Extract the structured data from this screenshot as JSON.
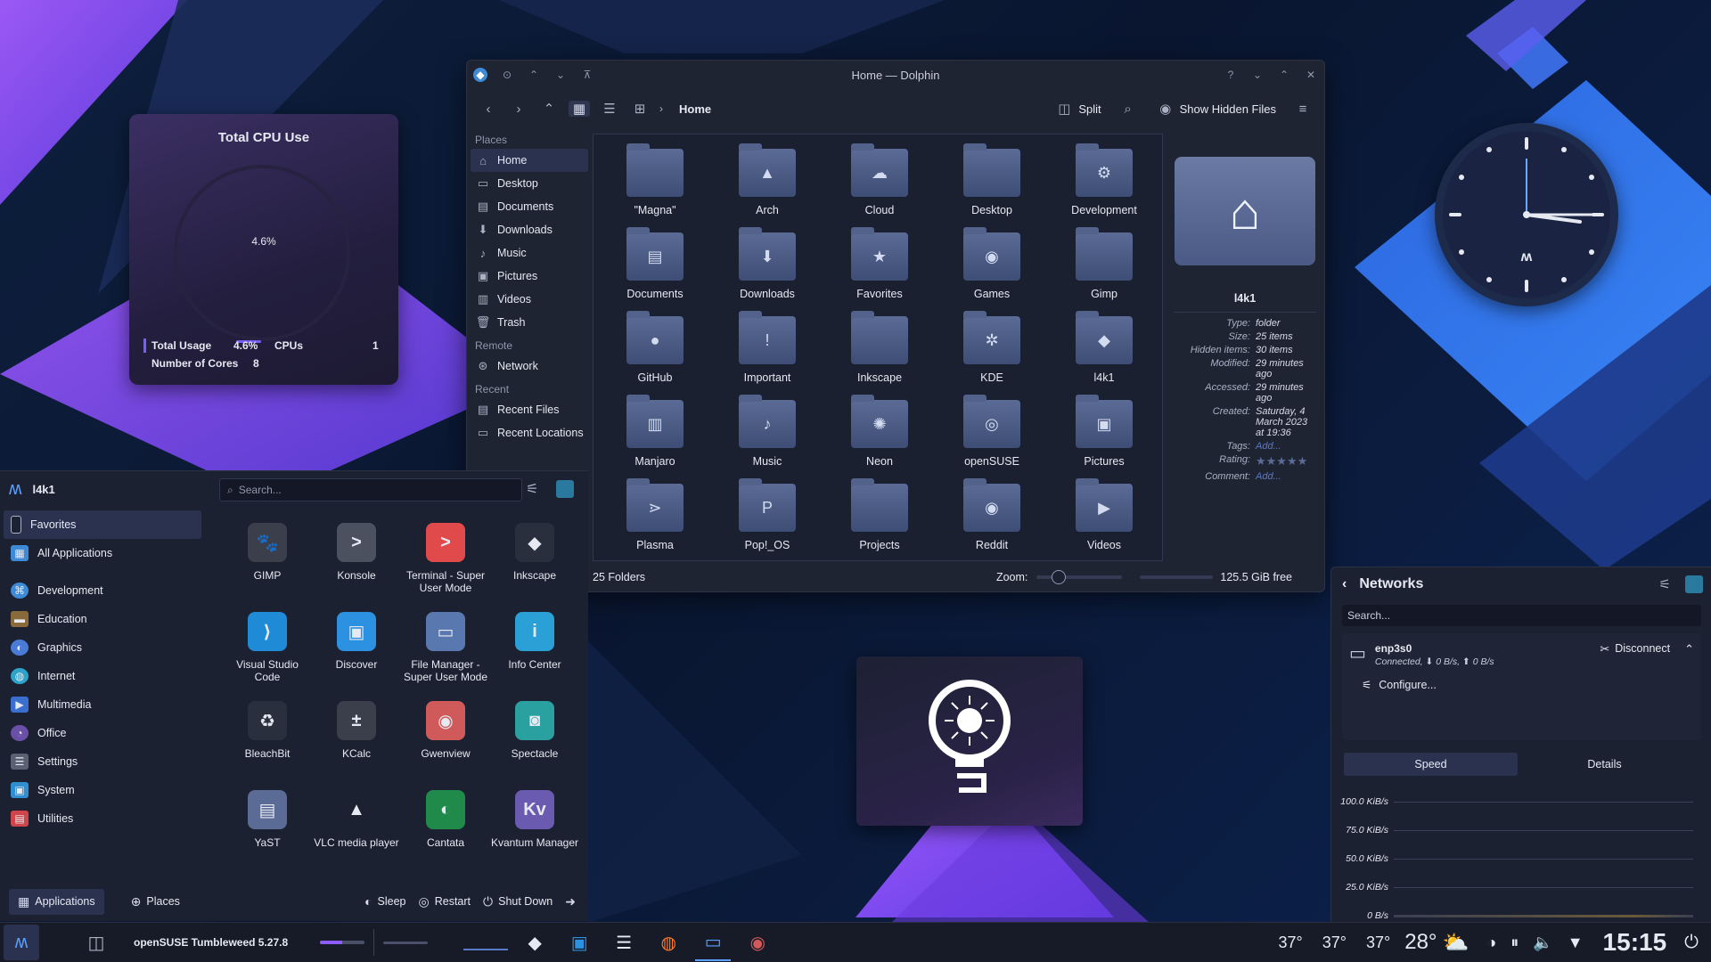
{
  "cpu_widget": {
    "title": "Total CPU Use",
    "percent": "4.6%",
    "total_usage_label": "Total Usage",
    "total_usage_value": "4.6%",
    "cpus_label": "CPUs",
    "cpus_value": "1",
    "cores_label": "Number of Cores",
    "cores_value": "8"
  },
  "dolphin": {
    "title": "Home — Dolphin",
    "breadcrumb": "Home",
    "split_label": "Split",
    "hidden_label": "Show Hidden Files",
    "places_header": "Places",
    "remote_header": "Remote",
    "recent_header": "Recent",
    "places": [
      {
        "label": "Home"
      },
      {
        "label": "Desktop"
      },
      {
        "label": "Documents"
      },
      {
        "label": "Downloads"
      },
      {
        "label": "Music"
      },
      {
        "label": "Pictures"
      },
      {
        "label": "Videos"
      },
      {
        "label": "Trash"
      }
    ],
    "remote": [
      {
        "label": "Network"
      }
    ],
    "recent": [
      {
        "label": "Recent Files"
      },
      {
        "label": "Recent Locations"
      }
    ],
    "folders": [
      {
        "name": "\"Magna\"",
        "glyph": ""
      },
      {
        "name": "Arch",
        "glyph": "▲"
      },
      {
        "name": "Cloud",
        "glyph": "☁"
      },
      {
        "name": "Desktop",
        "glyph": ""
      },
      {
        "name": "Development",
        "glyph": "⚙"
      },
      {
        "name": "Documents",
        "glyph": "▤"
      },
      {
        "name": "Downloads",
        "glyph": "⬇"
      },
      {
        "name": "Favorites",
        "glyph": "★"
      },
      {
        "name": "Games",
        "glyph": "◉"
      },
      {
        "name": "Gimp",
        "glyph": ""
      },
      {
        "name": "GitHub",
        "glyph": "●"
      },
      {
        "name": "Important",
        "glyph": "!"
      },
      {
        "name": "Inkscape",
        "glyph": ""
      },
      {
        "name": "KDE",
        "glyph": "✲"
      },
      {
        "name": "l4k1",
        "glyph": "◆"
      },
      {
        "name": "Manjaro",
        "glyph": "▥"
      },
      {
        "name": "Music",
        "glyph": "♪"
      },
      {
        "name": "Neon",
        "glyph": "✺"
      },
      {
        "name": "openSUSE",
        "glyph": "◎"
      },
      {
        "name": "Pictures",
        "glyph": "▣"
      },
      {
        "name": "Plasma",
        "glyph": "⋗"
      },
      {
        "name": "Pop!_OS",
        "glyph": "P"
      },
      {
        "name": "Projects",
        "glyph": ""
      },
      {
        "name": "Reddit",
        "glyph": "◉"
      },
      {
        "name": "Videos",
        "glyph": "▶"
      }
    ],
    "info": {
      "name": "l4k1",
      "type_label": "Type:",
      "type": "folder",
      "size_label": "Size:",
      "size": "25 items",
      "hidden_label": "Hidden items:",
      "hidden": "30 items",
      "modified_label": "Modified:",
      "modified": "29 minutes ago",
      "accessed_label": "Accessed:",
      "accessed": "29 minutes ago",
      "created_label": "Created:",
      "created": "Saturday, 4 March 2023 at 19:36",
      "tags_label": "Tags:",
      "tags": "Add...",
      "rating_label": "Rating:",
      "rating": "★★★★★",
      "comment_label": "Comment:",
      "comment": "Add..."
    },
    "status_folders": "25 Folders",
    "zoom_label": "Zoom:",
    "free_space": "125.5 GiB free",
    "zoom_level": 0.2
  },
  "launcher": {
    "user": "l4k1",
    "search_placeholder": "Search...",
    "categories": [
      {
        "label": "Favorites",
        "color": "#1b2233"
      },
      {
        "label": "All Applications",
        "color": "#3d8bd6"
      },
      {
        "label": "Development",
        "color": "#3d8bd6"
      },
      {
        "label": "Education",
        "color": "#8a6a3a"
      },
      {
        "label": "Graphics",
        "color": "#4a7bd6"
      },
      {
        "label": "Internet",
        "color": "#2ea3c9"
      },
      {
        "label": "Multimedia",
        "color": "#3a6fd0"
      },
      {
        "label": "Office",
        "color": "#6a4fa8"
      },
      {
        "label": "Settings",
        "color": "#5a6172"
      },
      {
        "label": "System",
        "color": "#2f8fd0"
      },
      {
        "label": "Utilities",
        "color": "#d0454a"
      }
    ],
    "apps": [
      {
        "label": "GIMP",
        "bg": "#3b3f4c",
        "glyph": "🐾"
      },
      {
        "label": "Konsole",
        "bg": "#4c5160",
        "glyph": ">"
      },
      {
        "label": "Terminal - Super User Mode",
        "bg": "#e04a4a",
        "glyph": ">"
      },
      {
        "label": "Inkscape",
        "bg": "#2a2f3d",
        "glyph": "◆"
      },
      {
        "label": "Visual Studio Code",
        "bg": "#1f8ad6",
        "glyph": "⟩"
      },
      {
        "label": "Discover",
        "bg": "#2b91e0",
        "glyph": "▣"
      },
      {
        "label": "File Manager - Super User Mode",
        "bg": "#5a78b0",
        "glyph": "▭"
      },
      {
        "label": "Info Center",
        "bg": "#2aa0d6",
        "glyph": "i"
      },
      {
        "label": "BleachBit",
        "bg": "#2a2f3d",
        "glyph": "♻"
      },
      {
        "label": "KCalc",
        "bg": "#3b3f4c",
        "glyph": "±"
      },
      {
        "label": "Gwenview",
        "bg": "#d05a5a",
        "glyph": "◉"
      },
      {
        "label": "Spectacle",
        "bg": "#2aa0a0",
        "glyph": "◙"
      },
      {
        "label": "YaST",
        "bg": "#5a6b95",
        "glyph": "▤"
      },
      {
        "label": "VLC media player",
        "bg": "#1c2131",
        "glyph": "▲"
      },
      {
        "label": "Cantata",
        "bg": "#1f8a4a",
        "glyph": "◐"
      },
      {
        "label": "Kvantum Manager",
        "bg": "#6a5ab0",
        "glyph": "Kv"
      }
    ],
    "footer": {
      "applications": "Applications",
      "places": "Places",
      "sleep": "Sleep",
      "restart": "Restart",
      "shutdown": "Shut Down"
    }
  },
  "networks": {
    "title": "Networks",
    "search_placeholder": "Search...",
    "connection": {
      "name": "enp3s0",
      "status": "Connected, ⬇ 0 B/s, ⬆ 0 B/s",
      "disconnect": "Disconnect",
      "configure": "Configure..."
    },
    "tabs": [
      "Speed",
      "Details"
    ],
    "speed_labels": [
      "100.0 KiB/s",
      "75.0 KiB/s",
      "50.0 KiB/s",
      "25.0 KiB/s",
      "0 B/s"
    ]
  },
  "taskbar": {
    "window_title": "openSUSE Tumbleweed 5.27.8",
    "temp1": "37°",
    "temp2": "37°",
    "temp3": "37°",
    "weather": "28°",
    "clock": "15:15"
  },
  "colors": {
    "accent": "#8e5bff",
    "panel": "#1c2131",
    "highlight": "#2a3250"
  }
}
